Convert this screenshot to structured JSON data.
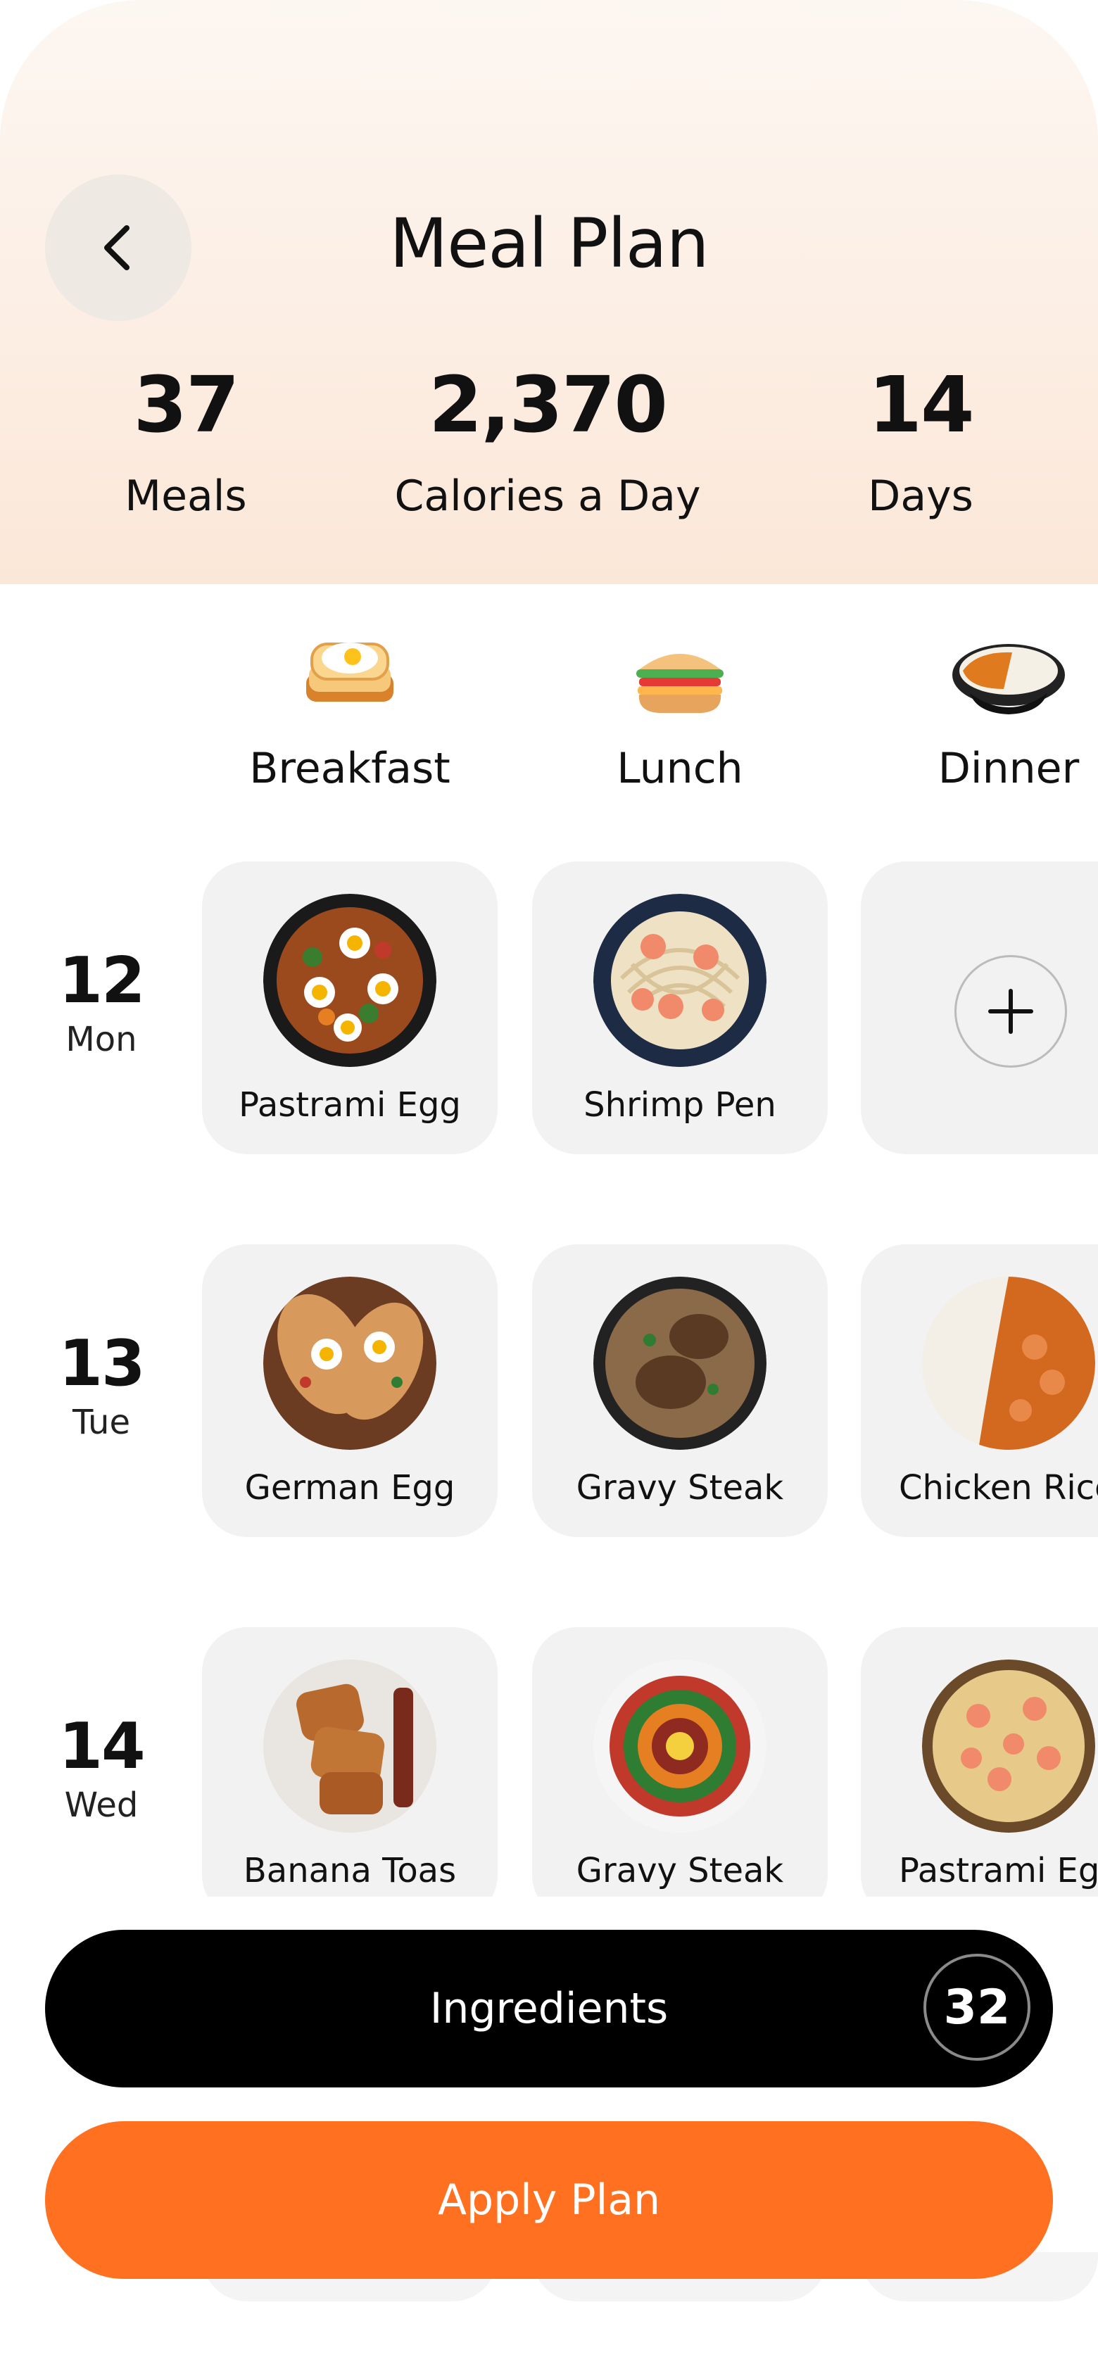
{
  "header": {
    "title": "Meal Plan",
    "stats": [
      {
        "value": "37",
        "label": "Meals"
      },
      {
        "value": "2,370",
        "label": "Calories a Day"
      },
      {
        "value": "14",
        "label": "Days"
      }
    ]
  },
  "columns": [
    {
      "label": "Breakfast",
      "icon": "toast-egg-icon"
    },
    {
      "label": "Lunch",
      "icon": "sandwich-icon"
    },
    {
      "label": "Dinner",
      "icon": "curry-bowl-icon"
    }
  ],
  "days": [
    {
      "number": "12",
      "weekday": "Mon",
      "meals": [
        "Pastrami Egg",
        "Shrimp Pen",
        ""
      ]
    },
    {
      "number": "13",
      "weekday": "Tue",
      "meals": [
        "German Egg",
        "Gravy Steak",
        "Chicken Rice"
      ]
    },
    {
      "number": "14",
      "weekday": "Wed",
      "meals": [
        "Banana Toas",
        "Gravy Steak",
        "Pastrami Egg"
      ]
    }
  ],
  "buttons": {
    "ingredients_label": "Ingredients",
    "ingredients_count": "32",
    "apply_label": "Apply Plan"
  },
  "colors": {
    "accent": "#ff7020",
    "header_gradient_top": "#fdf7f2",
    "header_gradient_bottom": "#fbe7d8",
    "card": "#f2f2f2"
  }
}
